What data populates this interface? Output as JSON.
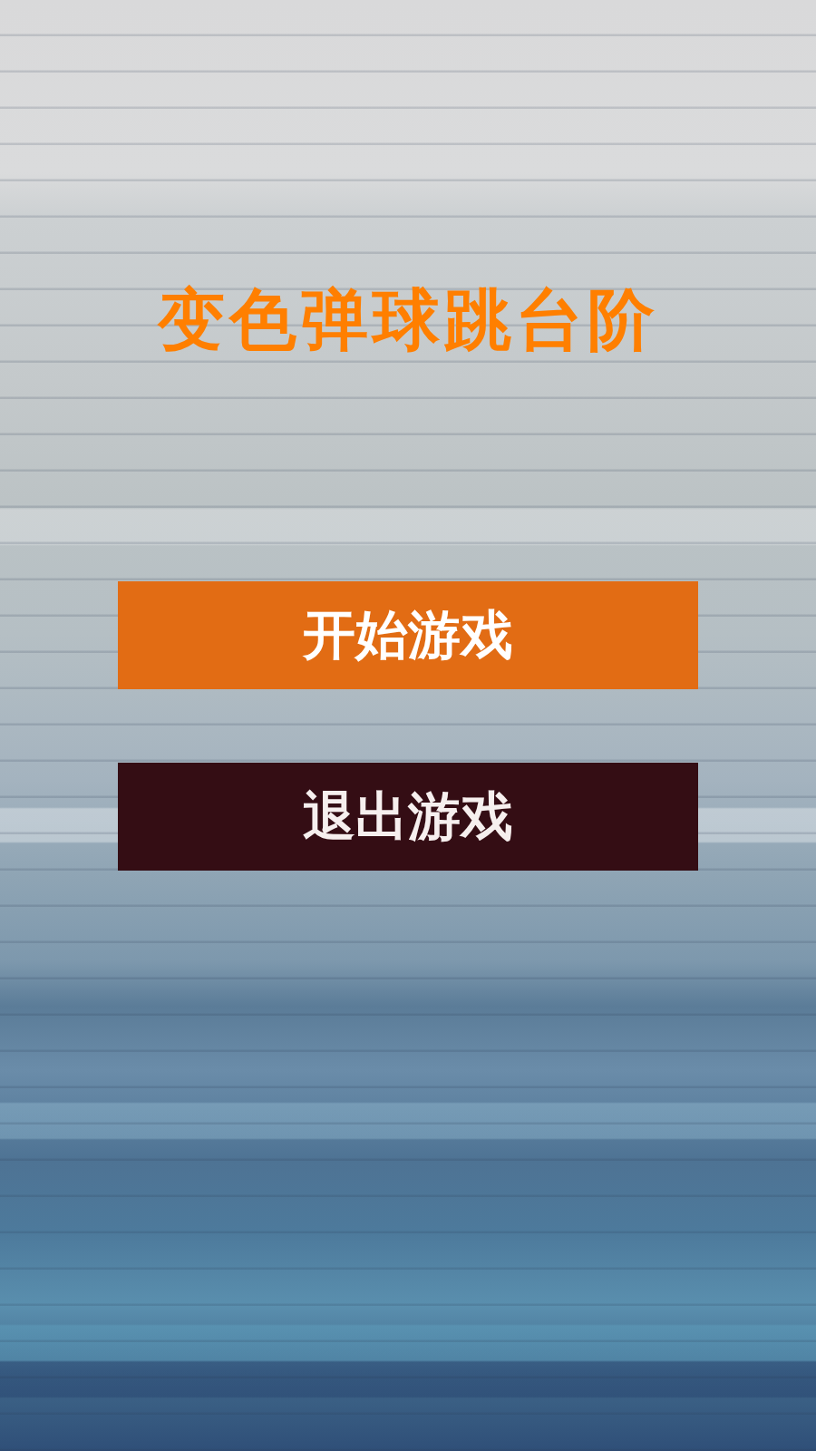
{
  "title": "变色弹球跳台阶",
  "buttons": [
    {
      "label": "开始游戏",
      "kind": "start"
    },
    {
      "label": "退出游戏",
      "kind": "exit"
    }
  ]
}
